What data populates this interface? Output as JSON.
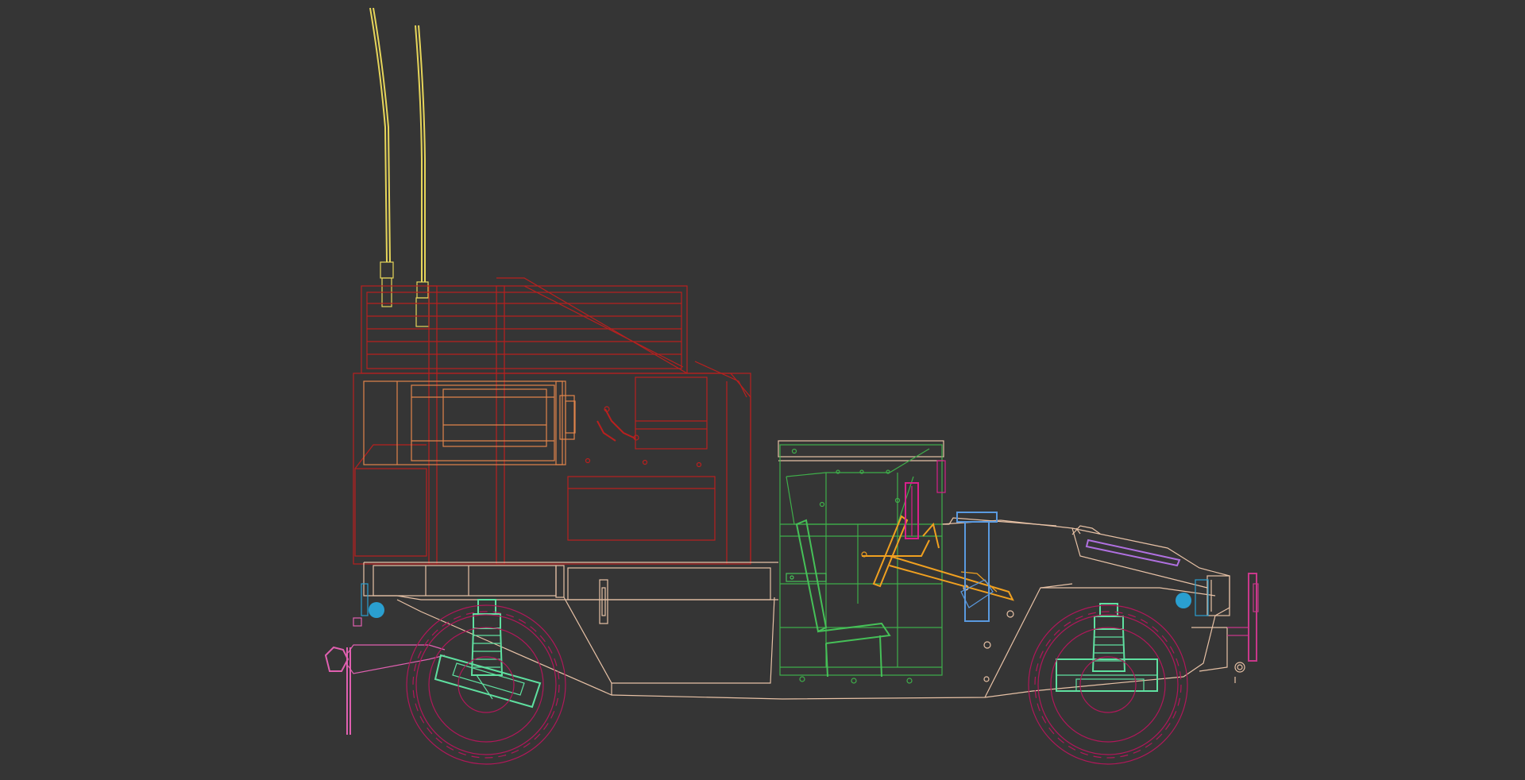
{
  "viewport": {
    "background": "#353535",
    "view": "side-orthographic",
    "render_mode": "wireframe"
  },
  "colors": {
    "antenna": "#e6d55a",
    "cargo_box": "#b8201f",
    "box_inner": "#e0844a",
    "body": "#e8c2a6",
    "cab_frame": "#3fae4a",
    "seat": "#46c058",
    "steering": "#f0a020",
    "pedal": "#d8208a",
    "suspension": "#5fe0a0",
    "wheel": "#b0185a",
    "tow_hitch": "#e060b0",
    "headlight": "#2a9fd0",
    "exhaust_stack": "#5a9ae0",
    "hood_vent": "#b070e0",
    "mirror": "#c8388a"
  },
  "objects": [
    {
      "name": "antenna-left",
      "color_key": "antenna"
    },
    {
      "name": "antenna-right",
      "color_key": "antenna"
    },
    {
      "name": "cargo-roof-box",
      "color_key": "cargo_box"
    },
    {
      "name": "cargo-shelter",
      "color_key": "cargo_box"
    },
    {
      "name": "equipment-rack",
      "color_key": "box_inner"
    },
    {
      "name": "vehicle-body",
      "color_key": "body"
    },
    {
      "name": "cab-frame",
      "color_key": "cab_frame"
    },
    {
      "name": "driver-seat",
      "color_key": "seat"
    },
    {
      "name": "steering-column",
      "color_key": "steering"
    },
    {
      "name": "brake-pedal",
      "color_key": "pedal"
    },
    {
      "name": "rear-suspension",
      "color_key": "suspension"
    },
    {
      "name": "front-suspension",
      "color_key": "suspension"
    },
    {
      "name": "rear-wheel",
      "color_key": "wheel"
    },
    {
      "name": "front-wheel",
      "color_key": "wheel"
    },
    {
      "name": "tow-hitch",
      "color_key": "tow_hitch"
    },
    {
      "name": "rear-light",
      "color_key": "headlight"
    },
    {
      "name": "front-headlight",
      "color_key": "headlight"
    },
    {
      "name": "intake-stack",
      "color_key": "exhaust_stack"
    },
    {
      "name": "hood-vent",
      "color_key": "hood_vent"
    },
    {
      "name": "front-bumper-post",
      "color_key": "mirror"
    }
  ]
}
